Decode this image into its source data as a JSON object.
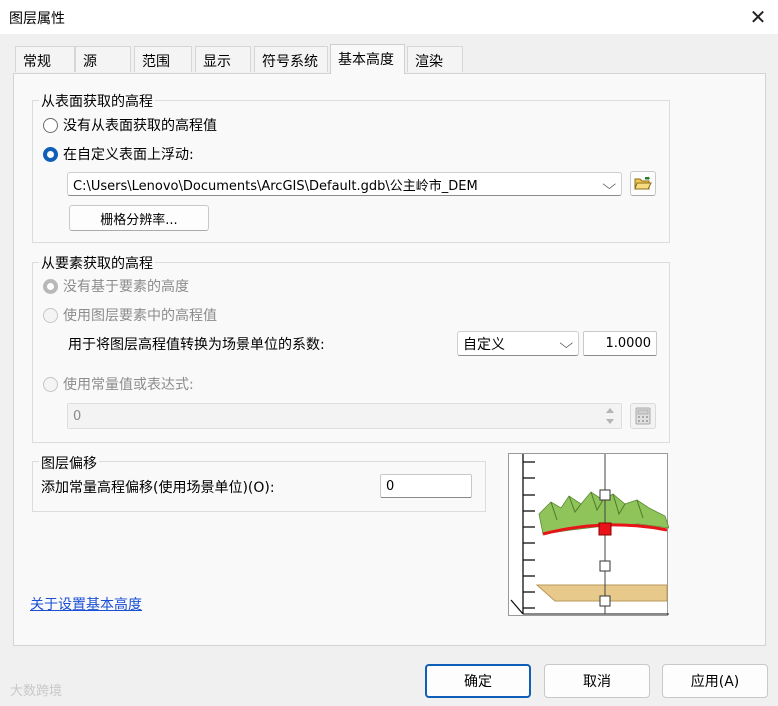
{
  "window": {
    "title": "图层属性",
    "close_glyph": "✕"
  },
  "tabs": [
    "常规",
    "源",
    "范围",
    "显示",
    "符号系统",
    "基本高度",
    "渲染"
  ],
  "surface_group": {
    "title": "从表面获取的高程",
    "option_none": "没有从表面获取的高程值",
    "option_float": "在自定义表面上浮动:",
    "surface_path": "C:\\Users\\Lenovo\\Documents\\ArcGIS\\Default.gdb\\公主岭市_DEM",
    "raster_res_button": "栅格分辨率..."
  },
  "feature_group": {
    "title": "从要素获取的高程",
    "option_none": "没有基于要素的高度",
    "option_layer_values": "使用图层要素中的高程值",
    "factor_label": "用于将图层高程值转换为场景单位的系数:",
    "factor_unit": "自定义",
    "factor_value": "1.0000",
    "option_expression": "使用常量值或表达式:",
    "expression_value": "0"
  },
  "offset_group": {
    "title": "图层偏移",
    "offset_label": "添加常量高程偏移(使用场景单位)(O):",
    "offset_value": "0"
  },
  "help_link": "关于设置基本高度",
  "buttons": {
    "ok": "确定",
    "cancel": "取消",
    "apply": "应用(A)"
  },
  "watermark": "大数跨境",
  "colors": {
    "accent": "#0f5fb8",
    "link": "#1a4fd6",
    "terrain": "#8fc45a",
    "surface_line": "#e8141a",
    "base_plane": "#e8c98c"
  }
}
